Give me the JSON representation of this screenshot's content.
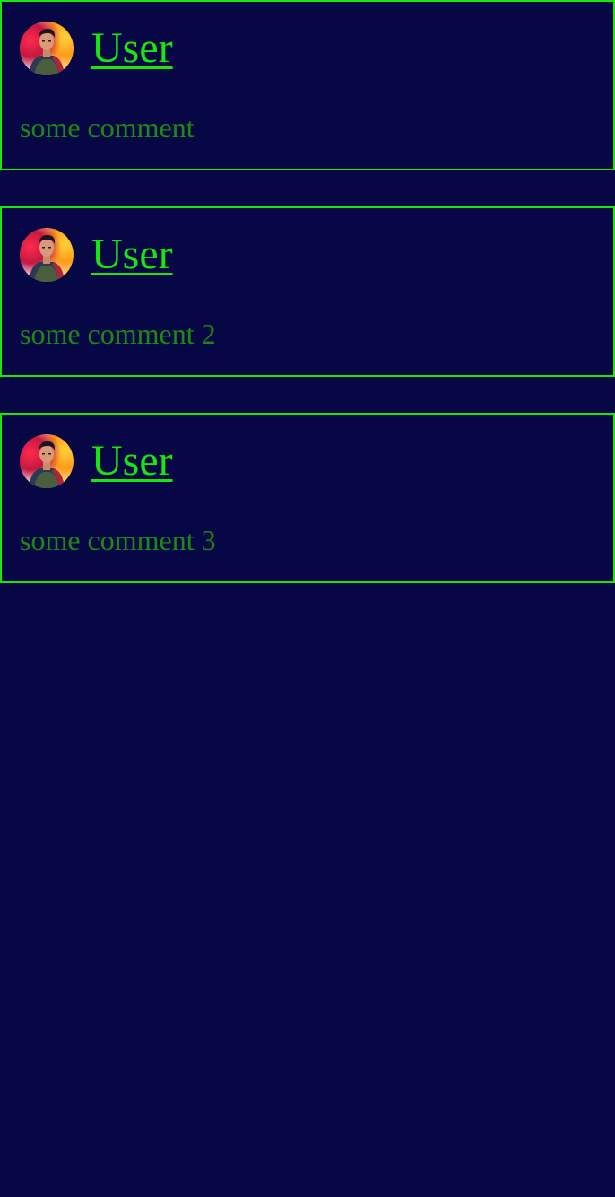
{
  "comments": [
    {
      "user": "User",
      "text": "some comment"
    },
    {
      "user": "User",
      "text": "some comment 2"
    },
    {
      "user": "User",
      "text": "some comment 3"
    }
  ],
  "colors": {
    "background": "#080746",
    "border": "#14e80d",
    "username": "#14e80d",
    "comment_text": "#1a8a12"
  },
  "icons": {
    "avatar": "avatar-image"
  }
}
